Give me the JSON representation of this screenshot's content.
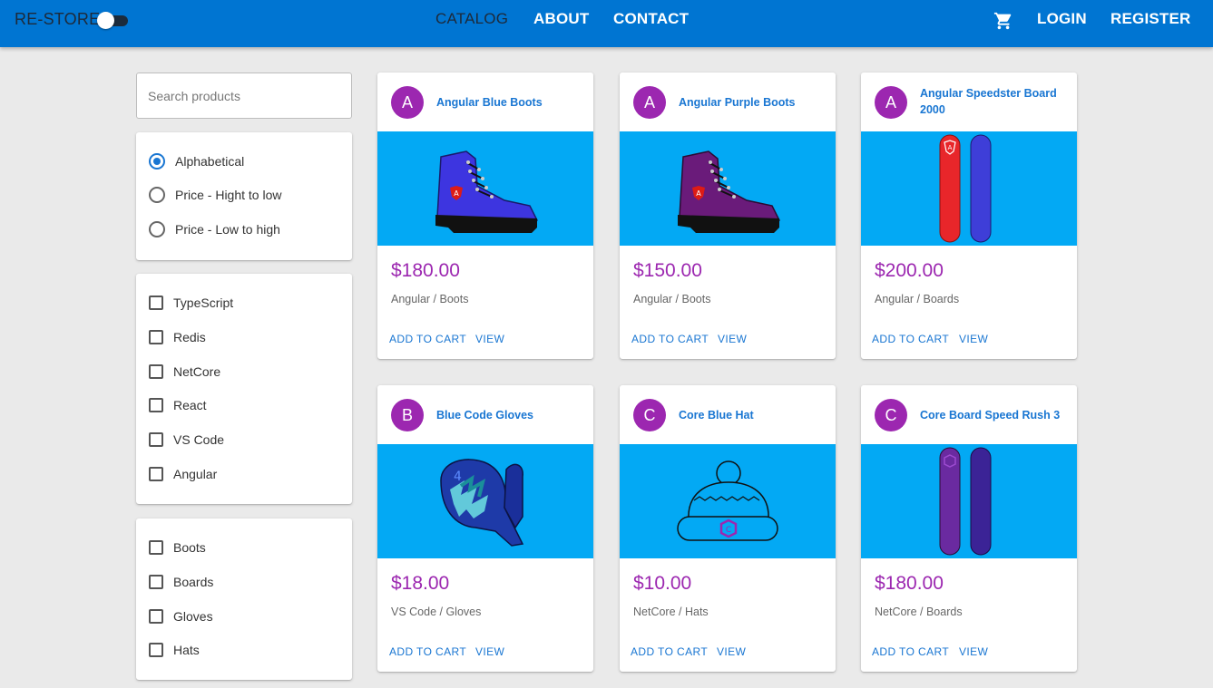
{
  "header": {
    "brand": "RE-STORE",
    "nav": [
      "CATALOG",
      "ABOUT",
      "CONTACT"
    ],
    "right": [
      "LOGIN",
      "REGISTER"
    ],
    "cart_icon": "shopping-cart-icon",
    "colors": {
      "appbar": "#0075d2"
    }
  },
  "search": {
    "placeholder": "Search products"
  },
  "sort": {
    "options": [
      "Alphabetical",
      "Price - Hight to low",
      "Price - Low to high"
    ],
    "selected": "Alphabetical"
  },
  "brands": [
    "TypeScript",
    "Redis",
    "NetCore",
    "React",
    "VS Code",
    "Angular"
  ],
  "types": [
    "Boots",
    "Boards",
    "Gloves",
    "Hats"
  ],
  "products": [
    {
      "initial": "A",
      "name": "Angular Blue Boots",
      "price": "$180.00",
      "brand_type": "Angular / Boots",
      "image": "blue-boot"
    },
    {
      "initial": "A",
      "name": "Angular Purple Boots",
      "price": "$150.00",
      "brand_type": "Angular / Boots",
      "image": "purple-boot"
    },
    {
      "initial": "A",
      "name": "Angular Speedster Board 2000",
      "price": "$200.00",
      "brand_type": "Angular / Boards",
      "image": "red-blue-board"
    },
    {
      "initial": "B",
      "name": "Blue Code Gloves",
      "price": "$18.00",
      "brand_type": "VS Code / Gloves",
      "image": "blue-glove"
    },
    {
      "initial": "C",
      "name": "Core Blue Hat",
      "price": "$10.00",
      "brand_type": "NetCore / Hats",
      "image": "blue-hat"
    },
    {
      "initial": "C",
      "name": "Core Board Speed Rush 3",
      "price": "$180.00",
      "brand_type": "NetCore / Boards",
      "image": "purple-board"
    }
  ],
  "card_actions": {
    "add": "ADD TO CART",
    "view": "VIEW"
  },
  "colors": {
    "price": "#9c27b0",
    "avatar": "#9c27b0",
    "media_bg": "#03a9f4",
    "link": "#1976d2"
  }
}
